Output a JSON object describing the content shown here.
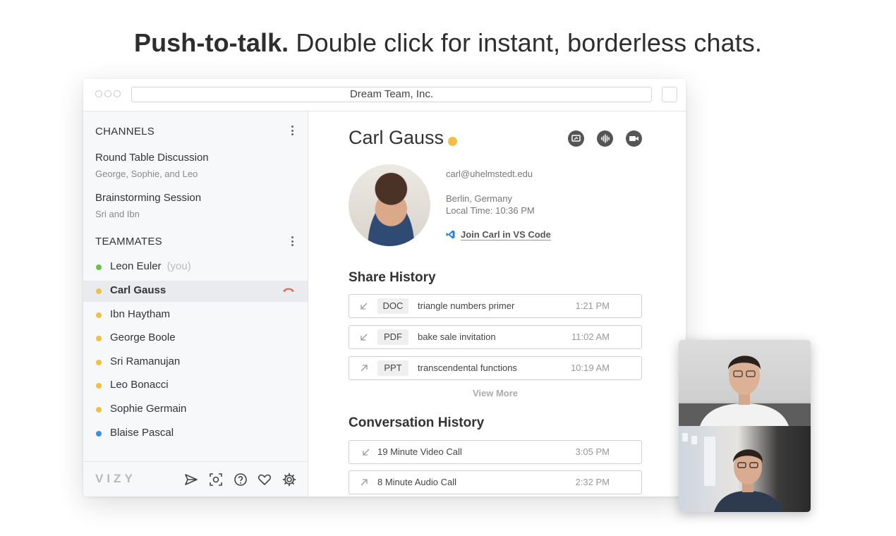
{
  "headline": {
    "bold": "Push-to-talk.",
    "rest": " Double click for instant, borderless chats."
  },
  "window": {
    "address": "Dream Team, Inc."
  },
  "sidebar": {
    "channels_heading": "CHANNELS",
    "channels": [
      {
        "name": "Round Table Discussion",
        "members": "George, Sophie, and Leo"
      },
      {
        "name": "Brainstorming Session",
        "members": "Sri and Ibn"
      }
    ],
    "teammates_heading": "TEAMMATES",
    "teammates": [
      {
        "name": "Leon Euler",
        "suffix": "(you)",
        "status_color": "#6cc04a"
      },
      {
        "name": "Carl Gauss",
        "status_color": "#f3c044",
        "active": true
      },
      {
        "name": "Ibn Haytham",
        "status_color": "#f3c044"
      },
      {
        "name": "George Boole",
        "status_color": "#f3c044"
      },
      {
        "name": "Sri Ramanujan",
        "status_color": "#f3c044"
      },
      {
        "name": "Leo Bonacci",
        "status_color": "#f3c044"
      },
      {
        "name": "Sophie Germain",
        "status_color": "#f3c044"
      },
      {
        "name": "Blaise Pascal",
        "status_color": "#3d8de0"
      }
    ],
    "footer": {
      "logo": "VIZY",
      "icons": [
        "send-icon",
        "screenshot-icon",
        "help-icon",
        "heart-icon",
        "settings-icon"
      ]
    }
  },
  "profile": {
    "name": "Carl Gauss",
    "status_color": "#f3c044",
    "email": "carl@uhelmstedt.edu",
    "location": "Berlin, Germany",
    "local_time": "Local Time: 10:36 PM",
    "join_label": "Join Carl in VS Code",
    "action_icons": [
      "screen-share-icon",
      "audio-icon",
      "video-icon"
    ]
  },
  "share_history": {
    "heading": "Share History",
    "items": [
      {
        "direction": "incoming",
        "type": "DOC",
        "title": "triangle numbers primer",
        "time": "1:21 PM"
      },
      {
        "direction": "incoming",
        "type": "PDF",
        "title": "bake sale invitation",
        "time": "11:02 AM"
      },
      {
        "direction": "outgoing",
        "type": "PPT",
        "title": "transcendental functions",
        "time": "10:19 AM"
      }
    ],
    "view_more": "View More"
  },
  "conversation_history": {
    "heading": "Conversation History",
    "items": [
      {
        "direction": "incoming",
        "title": "19 Minute Video Call",
        "time": "3:05 PM"
      },
      {
        "direction": "outgoing",
        "title": "8 Minute Audio Call",
        "time": "2:32 PM"
      }
    ]
  },
  "colors": {
    "accent_vscode": "#2d7fd0",
    "hangup": "#e06a5a"
  }
}
